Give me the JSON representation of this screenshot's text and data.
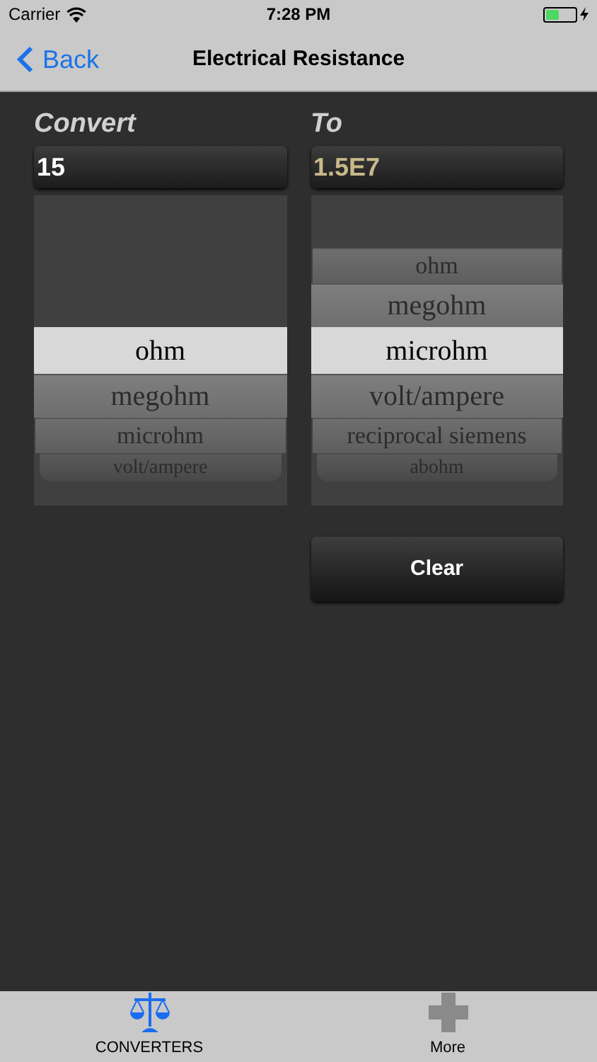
{
  "status_bar": {
    "carrier": "Carrier",
    "time": "7:28 PM",
    "charging": true
  },
  "nav": {
    "back": "Back",
    "title": "Electrical Resistance"
  },
  "from": {
    "label": "Convert",
    "value": "15",
    "picker": [
      {
        "label": "ohm",
        "selected": true
      },
      {
        "label": "megohm",
        "selected": false
      },
      {
        "label": "microhm",
        "selected": false
      },
      {
        "label": "volt/ampere",
        "selected": false
      }
    ]
  },
  "to": {
    "label": "To",
    "value": "1.5E7",
    "picker": [
      {
        "label": "ohm",
        "selected": false
      },
      {
        "label": "megohm",
        "selected": false
      },
      {
        "label": "microhm",
        "selected": true
      },
      {
        "label": "volt/ampere",
        "selected": false
      },
      {
        "label": "reciprocal siemens",
        "selected": false
      },
      {
        "label": "abohm",
        "selected": false
      }
    ]
  },
  "clear_button": "Clear",
  "tab_bar": [
    {
      "label": "CONVERTERS",
      "kind": "scales",
      "selected": true
    },
    {
      "label": "More",
      "kind": "plus",
      "selected": false
    }
  ]
}
